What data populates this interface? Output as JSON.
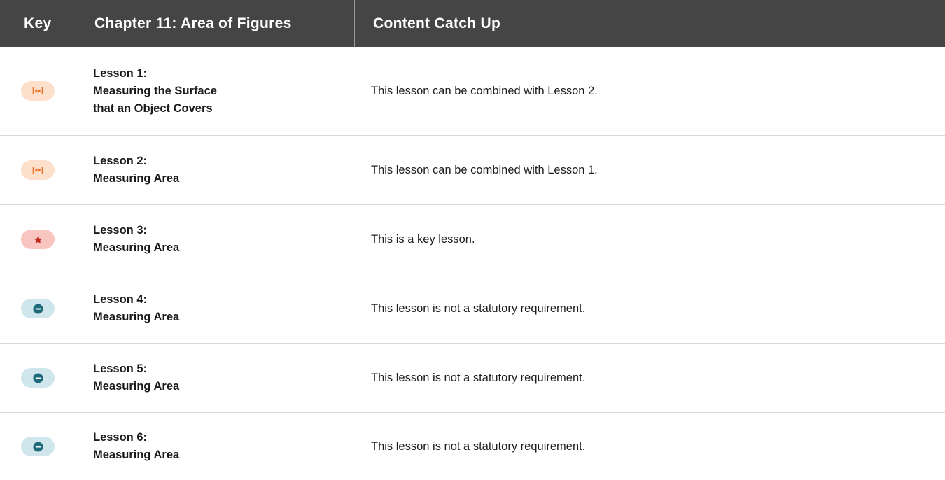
{
  "header": {
    "key_label": "Key",
    "chapter_label": "Chapter 11: Area of Figures",
    "catchup_label": "Content Catch Up"
  },
  "colors": {
    "header_bg": "#454545",
    "combine_pill": "#fde0cc",
    "combine_icon": "#e8702a",
    "key_pill": "#f9c5c0",
    "key_icon": "#c0281e",
    "optional_pill": "#cfe6ec",
    "optional_icon": "#1f6a7a"
  },
  "rows": [
    {
      "icon": "combine-arrows-icon",
      "lesson_line1": "Lesson 1:",
      "lesson_line2": "Measuring the Surface",
      "lesson_line3": "that an Object Covers",
      "catchup": "This lesson can be combined with Lesson 2."
    },
    {
      "icon": "combine-arrows-icon",
      "lesson_line1": "Lesson 2:",
      "lesson_line2": "Measuring Area",
      "catchup": "This lesson can be combined with Lesson 1."
    },
    {
      "icon": "star-icon",
      "lesson_line1": "Lesson 3:",
      "lesson_line2": "Measuring Area",
      "catchup": "This is a key lesson."
    },
    {
      "icon": "minus-circle-icon",
      "lesson_line1": "Lesson 4:",
      "lesson_line2": "Measuring Area",
      "catchup": "This lesson is not a statutory requirement."
    },
    {
      "icon": "minus-circle-icon",
      "lesson_line1": "Lesson 5:",
      "lesson_line2": "Measuring Area",
      "catchup": "This lesson is not a statutory requirement."
    },
    {
      "icon": "minus-circle-icon",
      "lesson_line1": "Lesson 6:",
      "lesson_line2": "Measuring Area",
      "catchup": "This lesson is not a statutory requirement."
    }
  ]
}
